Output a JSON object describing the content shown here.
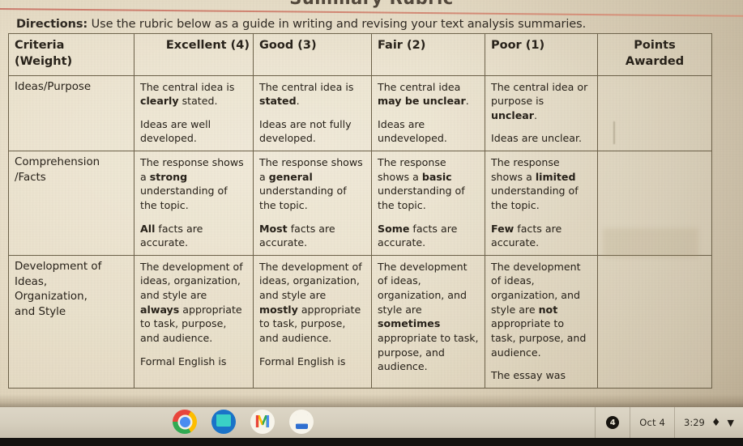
{
  "document": {
    "cut_off_title": "Summary Rubric",
    "directions_label": "Directions:",
    "directions_text": " Use the rubric below as a guide in writing and revising your text analysis summaries."
  },
  "rubric": {
    "headers": {
      "criteria": "Criteria\n(Weight)",
      "criteria_line1": "Criteria",
      "criteria_line2": "(Weight)",
      "excellent": "Excellent (4)",
      "good": "Good (3)",
      "fair": "Fair (2)",
      "poor": "Poor (1)",
      "points": "Points Awarded"
    },
    "rows": [
      {
        "criteria": "Ideas/Purpose",
        "excellent": [
          {
            "pre": "The central idea is ",
            "bold": "clearly",
            "post": " stated."
          },
          {
            "pre": "Ideas are well developed.",
            "bold": "",
            "post": ""
          }
        ],
        "good": [
          {
            "pre": "The central idea is ",
            "bold": "stated",
            "post": "."
          },
          {
            "pre": "Ideas are not fully developed.",
            "bold": "",
            "post": ""
          }
        ],
        "fair": [
          {
            "pre": "The central idea ",
            "bold": "may be unclear",
            "post": "."
          },
          {
            "pre": "Ideas are undeveloped.",
            "bold": "",
            "post": ""
          }
        ],
        "poor": [
          {
            "pre": "The central idea or purpose is ",
            "bold": "unclear",
            "post": "."
          },
          {
            "pre": "Ideas are unclear.",
            "bold": "",
            "post": ""
          }
        ],
        "points": ""
      },
      {
        "criteria": "Comprehension /Facts",
        "criteria_line1": "Comprehension",
        "criteria_line2": "/Facts",
        "excellent": [
          {
            "pre": "The response shows a ",
            "bold": "strong",
            "post": " understanding of the topic."
          },
          {
            "pre": "",
            "bold": "All",
            "post": " facts are accurate."
          }
        ],
        "good": [
          {
            "pre": "The response shows a ",
            "bold": "general",
            "post": " understanding of the topic."
          },
          {
            "pre": "",
            "bold": "Most",
            "post": " facts are accurate."
          }
        ],
        "fair": [
          {
            "pre": "The response shows a ",
            "bold": "basic",
            "post": " understanding of the topic."
          },
          {
            "pre": "",
            "bold": "Some",
            "post": " facts are accurate."
          }
        ],
        "poor": [
          {
            "pre": "The response shows a ",
            "bold": "limited",
            "post": " understanding of the topic."
          },
          {
            "pre": "",
            "bold": "Few",
            "post": " facts are accurate."
          }
        ],
        "points": ""
      },
      {
        "criteria": "Development of Ideas, Organization, and Style",
        "criteria_line1": "Development of",
        "criteria_line2": "Ideas,",
        "criteria_line3": "Organization,",
        "criteria_line4": "and Style",
        "excellent": [
          {
            "pre": "The development of ideas, organization, and style are ",
            "bold": "always",
            "post": " appropriate to task, purpose, and audience."
          },
          {
            "pre": "Formal English is",
            "bold": "",
            "post": ""
          }
        ],
        "good": [
          {
            "pre": "The development of ideas, organization, and style are ",
            "bold": "mostly",
            "post": " appropriate to task, purpose, and audience."
          },
          {
            "pre": "Formal English is",
            "bold": "",
            "post": ""
          }
        ],
        "fair": [
          {
            "pre": "The development of ideas, organization, and style are ",
            "bold": "sometimes",
            "post": " appropriate to task, purpose, and audience."
          }
        ],
        "poor": [
          {
            "pre": "The development of ideas, organization, and style are ",
            "bold": "not",
            "post": " appropriate to task, purpose, and audience."
          },
          {
            "pre": "The essay was",
            "bold": "",
            "post": ""
          }
        ],
        "points": ""
      }
    ]
  },
  "shelf": {
    "apps": [
      {
        "name": "chrome-app-icon",
        "label": "Chrome"
      },
      {
        "name": "files-app-icon",
        "label": "Files"
      },
      {
        "name": "gmail-app-icon",
        "label": "Gmail",
        "glyph": "M"
      },
      {
        "name": "docs-app-icon",
        "label": "Google Docs"
      }
    ],
    "tray": {
      "notification_count": "4",
      "date": "Oct 4",
      "time": "3:29",
      "battery_glyph": "♦",
      "wifi_glyph": "▼"
    }
  },
  "colors": {
    "paper": "#e6dcc6",
    "rule_red": "#cf7a66",
    "ink": "#272119",
    "border": "#6c6149",
    "shelf": "#d6cfbe"
  }
}
